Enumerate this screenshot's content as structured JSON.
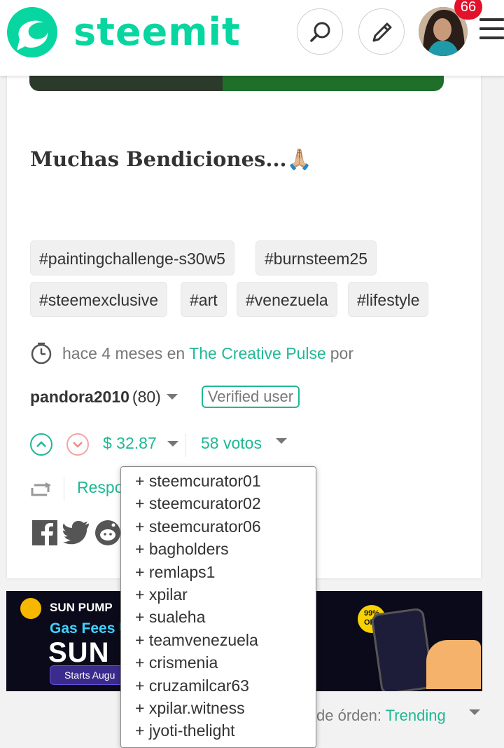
{
  "header": {
    "brand": "steemit",
    "notifications_count": "66"
  },
  "post": {
    "title": "Muchas Bendiciones...🙏🏼",
    "tags": [
      "#paintingchallenge-s30w5",
      "#burnsteem25",
      "#steemexclusive",
      "#art",
      "#venezuela",
      "#lifestyle"
    ],
    "meta_prefix": "hace 4 meses en",
    "community": "The Creative Pulse",
    "meta_suffix": "por",
    "author": "pandora2010",
    "reputation": "(80)",
    "verified": "Verified user",
    "payout": "$ 32.87",
    "votes": "58 votos",
    "reply": "Responder"
  },
  "voters": [
    "+ steemcurator01",
    "+ steemcurator02",
    "+ steemcurator06",
    "+ bagholders",
    "+ remlaps1",
    "+ xpilar",
    "+ sualeha",
    "+ teamvenezuela",
    "+ crismenia",
    "+ cruzamilcar63",
    "+ xpilar.witness",
    "+ jyoti-thelight"
  ],
  "ad": {
    "brand": "SUN PUMP",
    "line": "Gas Fees U",
    "big": "SUN",
    "pill": "Starts Augu",
    "offer": "99% OFF"
  },
  "sort": {
    "label": "de órden:",
    "value": "Trending"
  },
  "colors": {
    "accent": "#1fb894",
    "brand": "#07d6a0",
    "badge": "#e4112b"
  }
}
